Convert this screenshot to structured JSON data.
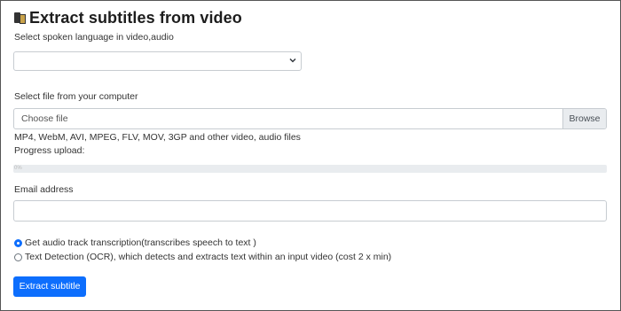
{
  "title": "Extract subtitles from video",
  "icons": {
    "title": "subtitle-app-icon",
    "select": "chevron-down-icon"
  },
  "language": {
    "label": "Select spoken language in video,audio",
    "selected": ""
  },
  "file": {
    "label": "Select file from your computer",
    "placeholder": "Choose file",
    "browse_label": "Browse",
    "formats_hint": "MP4, WebM, AVI, MPEG, FLV, MOV, 3GP and other video, audio files"
  },
  "progress": {
    "label": "Progress upload:",
    "percent_text": "0%",
    "value": 0
  },
  "email": {
    "label": "Email address",
    "value": ""
  },
  "mode": {
    "options": [
      {
        "label": "Get audio track transcription(transcribes speech to text )",
        "checked": true
      },
      {
        "label": "Text Detection (OCR), which detects and extracts text within an input video (cost 2 x min)",
        "checked": false
      }
    ]
  },
  "submit_label": "Extract subtitle",
  "colors": {
    "primary": "#0d6efd",
    "border": "#c7ccd1",
    "browse_bg": "#e9ecef"
  }
}
